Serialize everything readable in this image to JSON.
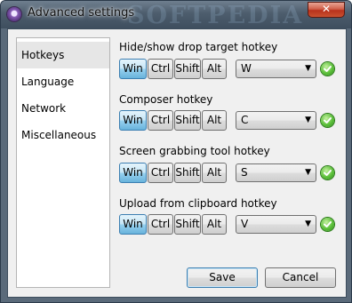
{
  "window": {
    "title": "Advanced settings",
    "close_glyph": "✕",
    "watermark": "SOFTPEDIA"
  },
  "sidebar": {
    "items": [
      {
        "label": "Hotkeys",
        "active": true
      },
      {
        "label": "Language",
        "active": false
      },
      {
        "label": "Network",
        "active": false
      },
      {
        "label": "Miscellaneous",
        "active": false
      }
    ]
  },
  "modifiers": {
    "win": "Win",
    "ctrl": "Ctrl",
    "shift": "Shift",
    "alt": "Alt"
  },
  "hotkeys": [
    {
      "label": "Hide/show drop target hotkey",
      "win": true,
      "ctrl": false,
      "shift": false,
      "alt": false,
      "key": "W",
      "valid": true
    },
    {
      "label": "Composer hotkey",
      "win": true,
      "ctrl": false,
      "shift": false,
      "alt": false,
      "key": "C",
      "valid": true
    },
    {
      "label": "Screen grabbing tool hotkey",
      "win": true,
      "ctrl": false,
      "shift": false,
      "alt": false,
      "key": "S",
      "valid": true
    },
    {
      "label": "Upload from clipboard hotkey",
      "win": true,
      "ctrl": false,
      "shift": false,
      "alt": false,
      "key": "V",
      "valid": true
    }
  ],
  "buttons": {
    "save": "Save",
    "cancel": "Cancel"
  },
  "icons": {
    "app": "app-icon",
    "close": "close-icon",
    "check": "check-icon",
    "dropdown": "chevron-down-icon"
  },
  "colors": {
    "accent": "#68b3db",
    "valid": "#5bbf3a",
    "close": "#c9502f"
  }
}
